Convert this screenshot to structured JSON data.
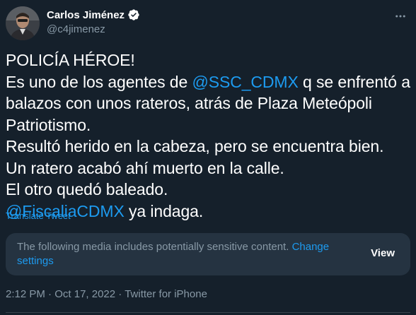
{
  "author": {
    "display_name": "Carlos Jiménez",
    "handle": "@c4jimenez",
    "verified": true,
    "avatar_icon": "profile-photo-avatar",
    "verified_icon": "verified-badge-icon",
    "more_icon": "more-options-icon"
  },
  "tweet": {
    "lines": [
      [
        {
          "text": "POLICÍA HÉROE!",
          "mention": false
        }
      ],
      [
        {
          "text": "Es uno de los agentes de ",
          "mention": false
        },
        {
          "text": "@SSC_CDMX",
          "mention": true
        },
        {
          "text": " q se enfrentó a",
          "mention": false
        }
      ],
      [
        {
          "text": "balazos con unos rateros, atrás de Plaza Meteópoli",
          "mention": false
        }
      ],
      [
        {
          "text": "Patriotismo.",
          "mention": false
        }
      ],
      [
        {
          "text": "Resultó herido en la cabeza, pero se encuentra bien.",
          "mention": false
        }
      ],
      [
        {
          "text": "Un ratero acabó ahí muerto en la calle.",
          "mention": false
        }
      ],
      [
        {
          "text": "El otro quedó baleado.",
          "mention": false
        }
      ],
      [
        {
          "text": "@FiscaliaCDMX",
          "mention": true
        },
        {
          "text": " ya indaga.",
          "mention": false
        }
      ]
    ],
    "translate_label": "Translate Tweet"
  },
  "sensitive": {
    "message": "The following media includes potentially sensitive content.",
    "change_settings_label": "Change settings",
    "view_label": "View"
  },
  "meta": {
    "time": "2:12 PM",
    "separator": "·",
    "date": "Oct 17, 2022",
    "source": "Twitter for iPhone"
  },
  "colors": {
    "background": "#15202b",
    "accent": "#1d9bf0",
    "secondary_text": "#8899a6",
    "card_background": "#253341"
  }
}
